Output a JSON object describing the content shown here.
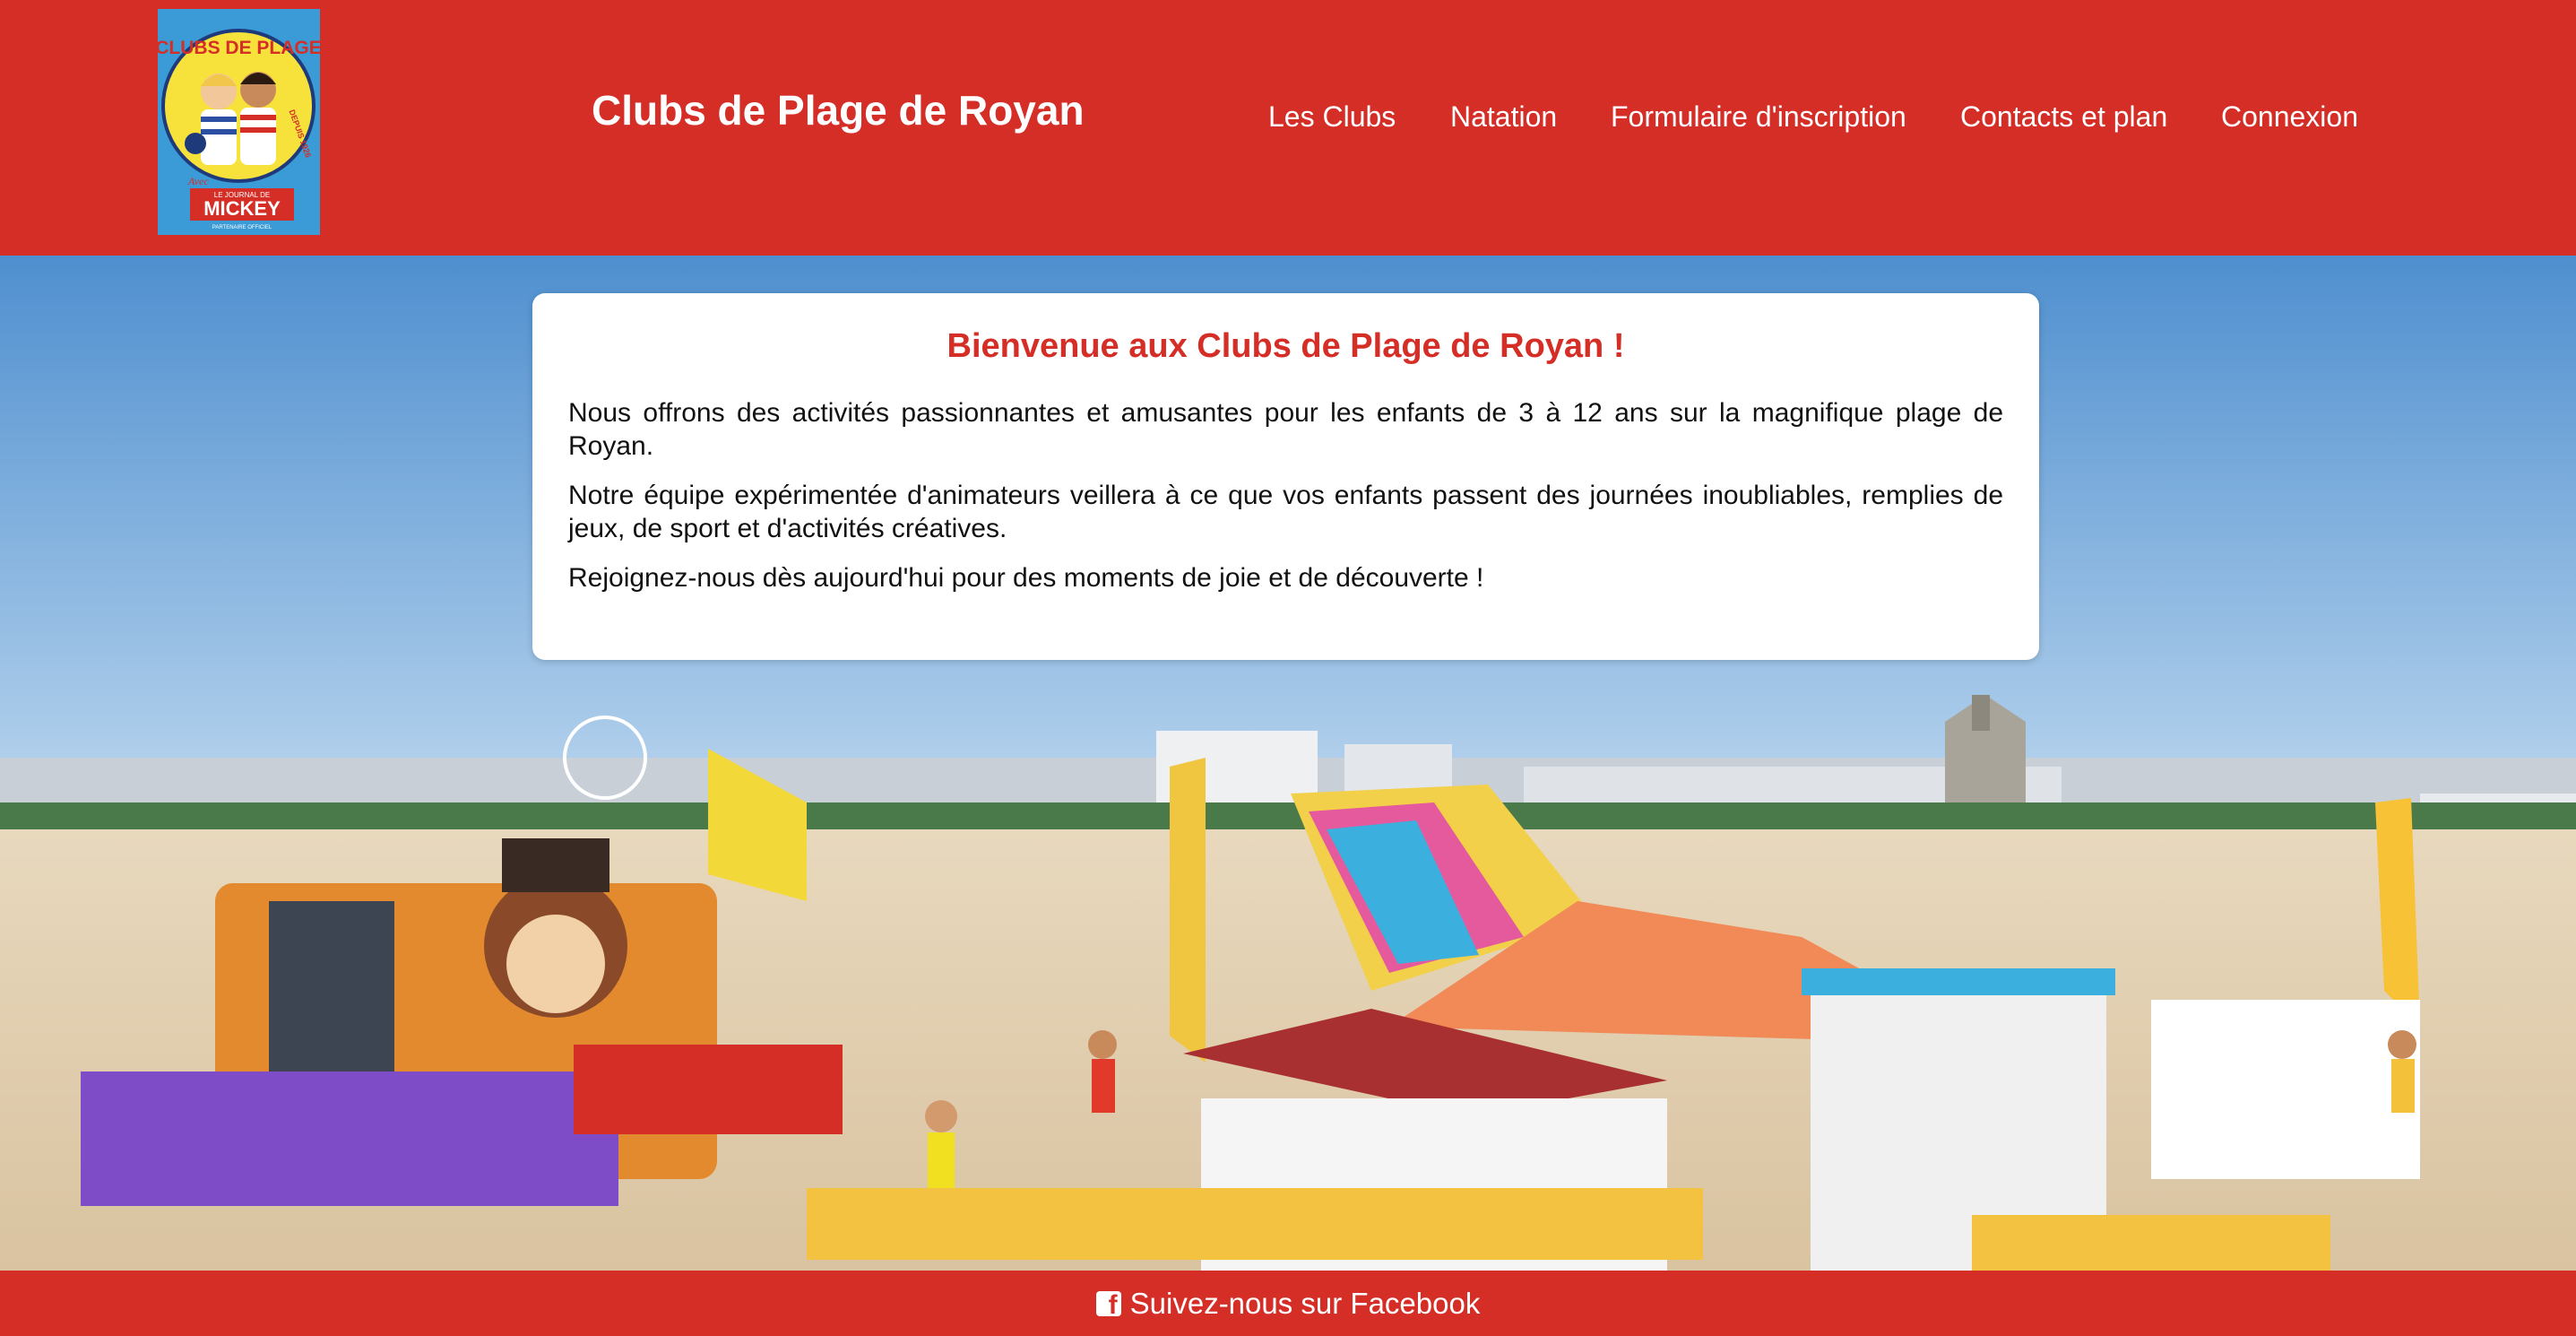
{
  "header": {
    "title": "Clubs de Plage de Royan",
    "logo": {
      "text_top": "CLUBS DE PLAGE",
      "text_side": "DEPUIS 1926",
      "text_avec": "Avec",
      "text_brand_small": "LE JOURNAL DE",
      "text_brand": "MICKEY",
      "text_partner": "PARTENAIRE OFFICIEL"
    },
    "nav": [
      "Les Clubs",
      "Natation",
      "Formulaire d'inscription",
      "Contacts et plan",
      "Connexion"
    ]
  },
  "main": {
    "card": {
      "title": "Bienvenue aux Clubs de Plage de Royan !",
      "paragraphs": [
        "Nous offrons des activités passionnantes et amusantes pour les enfants de 3 à 12 ans sur la magnifique plage de Royan.",
        "Notre équipe expérimentée d'animateurs veillera à ce que vos enfants passent des journées inoubliables, remplies de jeux, de sport et d'activités créatives.",
        "Rejoignez-nous dès aujourd'hui pour des moments de joie et de découverte !"
      ]
    }
  },
  "footer": {
    "facebook_label": "Suivez-nous sur Facebook",
    "facebook_icon": "facebook-square-icon"
  },
  "colors": {
    "brand_red": "#d42e27",
    "white": "#ffffff",
    "sky": "#7fb1dd",
    "sand": "#e5d5bb"
  }
}
